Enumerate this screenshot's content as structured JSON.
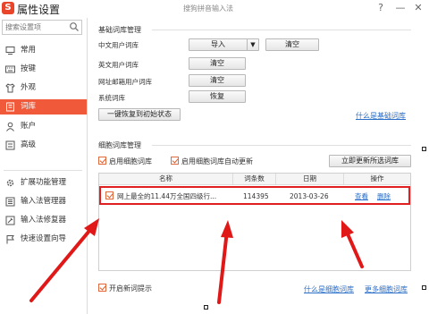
{
  "window": {
    "title": "属性设置",
    "subtitle": "搜狗拼音输入法",
    "logo": "S",
    "help": "?",
    "minimize": "—",
    "close": "✕"
  },
  "sidebar": {
    "search_placeholder": "搜索设置项",
    "items": [
      {
        "label": "常用",
        "icon": "monitor-icon"
      },
      {
        "label": "按键",
        "icon": "keyboard-icon"
      },
      {
        "label": "外观",
        "icon": "shirt-icon"
      },
      {
        "label": "词库",
        "icon": "book-icon",
        "active": true
      },
      {
        "label": "账户",
        "icon": "user-icon"
      },
      {
        "label": "高级",
        "icon": "advanced-icon"
      },
      {
        "label": "扩展功能管理",
        "icon": "extension-icon"
      },
      {
        "label": "输入法管理器",
        "icon": "manager-icon"
      },
      {
        "label": "输入法修复器",
        "icon": "repair-icon"
      },
      {
        "label": "快速设置向导",
        "icon": "flag-icon"
      }
    ]
  },
  "basic": {
    "title": "基础词库管理",
    "rows": [
      {
        "label": "中文用户词库"
      },
      {
        "label": "英文用户词库"
      },
      {
        "label": "网址邮箱用户词库"
      },
      {
        "label": "系统词库"
      }
    ],
    "import": "导入",
    "clear": "清空",
    "restore": "恢复",
    "reset": "一键恢复到初始状态",
    "link": "什么是基础词库"
  },
  "cell": {
    "title": "细胞词库管理",
    "enable": "启用细胞词库",
    "auto_update": "启用细胞词库自动更新",
    "update_now": "立即更新所选词库",
    "columns": [
      "名称",
      "词条数",
      "日期",
      "操作"
    ],
    "rows": [
      {
        "name": "网上最全的11.44万全国四级行...",
        "count": "114395",
        "date": "2013-03-26",
        "view": "查看",
        "delete": "删除"
      }
    ],
    "new_word_hint": "开启新词提示",
    "link1": "什么是细胞词库",
    "link2": "更多细胞词库"
  },
  "colors": {
    "accent": "#f05a3a",
    "highlight": "#e02020",
    "link": "#2a6ec8"
  }
}
